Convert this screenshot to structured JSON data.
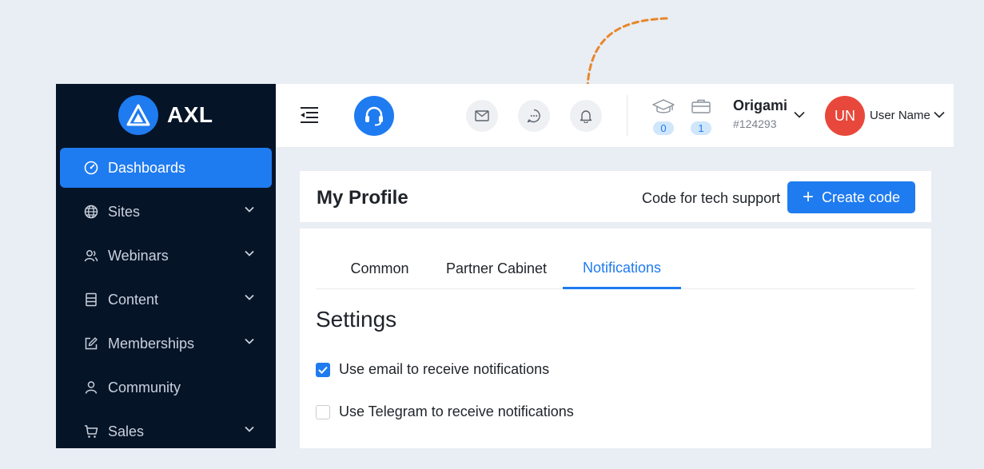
{
  "brand": {
    "name": "AXL"
  },
  "sidebar": {
    "items": [
      {
        "label": "Dashboards",
        "icon": "dashboard-icon",
        "active": true,
        "has_children": false
      },
      {
        "label": "Sites",
        "icon": "globe-icon",
        "active": false,
        "has_children": true
      },
      {
        "label": "Webinars",
        "icon": "users-icon",
        "active": false,
        "has_children": true
      },
      {
        "label": "Content",
        "icon": "document-icon",
        "active": false,
        "has_children": true
      },
      {
        "label": "Memberships",
        "icon": "edit-icon",
        "active": false,
        "has_children": true
      },
      {
        "label": "Community",
        "icon": "user-icon",
        "active": false,
        "has_children": false
      },
      {
        "label": "Sales",
        "icon": "cart-icon",
        "active": false,
        "has_children": true
      }
    ]
  },
  "header": {
    "courses_count": "0",
    "products_count": "1",
    "org": {
      "name": "Origami",
      "id": "#124293"
    },
    "user": {
      "initials": "UN",
      "name": "User Name"
    }
  },
  "profile": {
    "title": "My Profile",
    "tech_support_label": "Code for tech support",
    "create_code_label": "Create code"
  },
  "tabs": [
    {
      "label": "Common",
      "active": false
    },
    {
      "label": "Partner Cabinet",
      "active": false
    },
    {
      "label": "Notifications",
      "active": true
    }
  ],
  "settings": {
    "title": "Settings",
    "options": [
      {
        "label": "Use email to receive notifications",
        "checked": true
      },
      {
        "label": "Use Telegram to receive notifications",
        "checked": false
      }
    ]
  },
  "colors": {
    "accent": "#1f7bf0",
    "sidebar_bg": "#061428",
    "avatar_bg": "#e8483b",
    "annotation_arrow": "#e8872a"
  }
}
